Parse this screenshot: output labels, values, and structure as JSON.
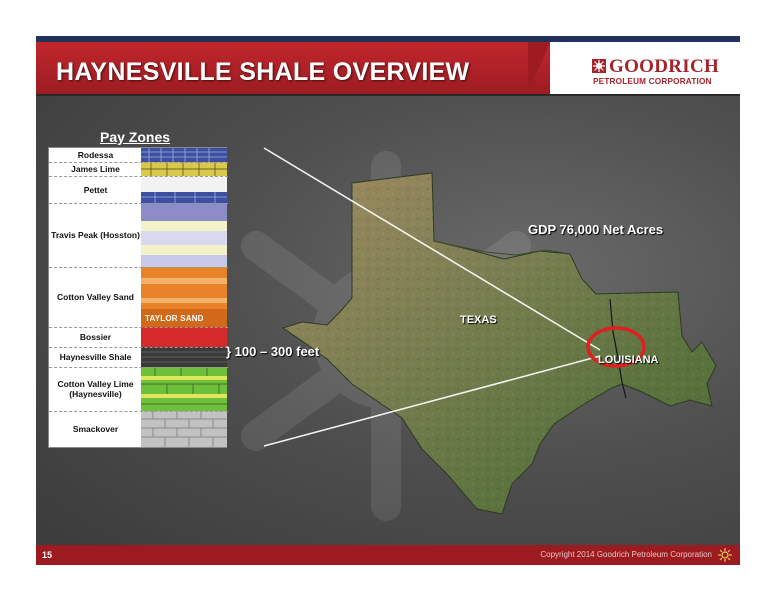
{
  "header": {
    "title": "HAYNESVILLE SHALE OVERVIEW",
    "logo_name": "GOODRICH",
    "logo_sub": "PETROLEUM CORPORATION"
  },
  "pay_zones": {
    "title": "Pay Zones",
    "zones": [
      {
        "label": "Rodessa"
      },
      {
        "label": "James Lime"
      },
      {
        "label": "Pettet"
      },
      {
        "label": "Travis Peak (Hosston)"
      },
      {
        "label": "Cotton Valley Sand"
      },
      {
        "label": "Bossier"
      },
      {
        "label": "Haynesville Shale"
      },
      {
        "label": "Cotton Valley Lime (Haynesville)"
      },
      {
        "label": "Smackover"
      }
    ],
    "taylor_sand": "TAYLOR SAND",
    "thickness": "} 100 – 300 feet"
  },
  "map": {
    "acreage": "GDP 76,000 Net Acres",
    "texas": "TEXAS",
    "louisiana": "LOUISIANA",
    "highlight_color": "#e02020"
  },
  "footer": {
    "page_number": "15",
    "copyright": "Copyright 2014 Goodrich Petroleum Corporation"
  },
  "colors": {
    "header_red": "#b0242a",
    "footer_red": "#9b1b21",
    "navy": "#23325a"
  }
}
